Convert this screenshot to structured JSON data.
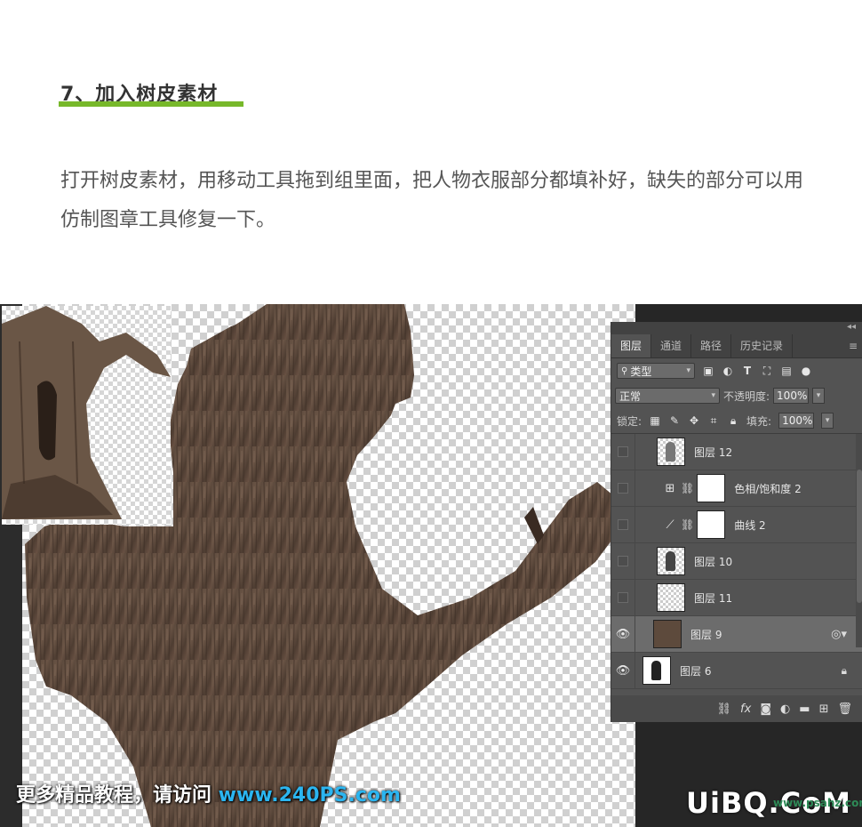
{
  "article": {
    "heading": "7、加入树皮素材",
    "paragraph": "打开树皮素材，用移动工具拖到组里面，把人物衣服部分都填补好，缺失的部分可以用仿制图章工具修复一下。"
  },
  "watermark": {
    "left_prefix": "更多精品教程，请访问 ",
    "left_url": "www.240PS.com",
    "right_brand": "UiBQ.CoM",
    "right_sub": "www.psahz.com"
  },
  "layers_panel": {
    "tabs": [
      "图层",
      "通道",
      "路径",
      "历史记录"
    ],
    "active_tab": "图层",
    "filter_kind": "类型",
    "blend_mode": "正常",
    "opacity_label": "不透明度:",
    "opacity_value": "100%",
    "lock_label": "锁定:",
    "fill_label": "填充:",
    "fill_value": "100%",
    "layers": [
      {
        "name": "图层 12",
        "visible": false,
        "kind": "pixel"
      },
      {
        "name": "色相/饱和度 2",
        "visible": false,
        "kind": "adjust-hue"
      },
      {
        "name": "曲线 2",
        "visible": false,
        "kind": "adjust-curve"
      },
      {
        "name": "图层 10",
        "visible": false,
        "kind": "pixel"
      },
      {
        "name": "图层 11",
        "visible": false,
        "kind": "pixel"
      },
      {
        "name": "图层 9",
        "visible": true,
        "kind": "bark",
        "selected": true
      },
      {
        "name": "图层 6",
        "visible": true,
        "kind": "pixel-locked"
      }
    ]
  }
}
